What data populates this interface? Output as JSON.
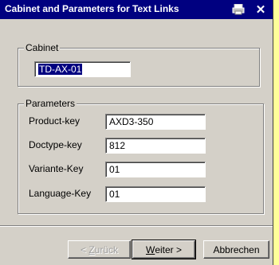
{
  "window": {
    "title": "Cabinet and Parameters for Text Links",
    "icons": [
      "printer-icon",
      "close-icon"
    ],
    "close_glyph": "✕"
  },
  "cabinet": {
    "group_label": "Cabinet",
    "value": "TD-AX-01"
  },
  "parameters": {
    "group_label": "Parameters",
    "fields": [
      {
        "label": "Product-key",
        "value": "AXD3-350"
      },
      {
        "label": "Doctype-key",
        "value": "812"
      },
      {
        "label": "Variante-Key",
        "value": "01"
      },
      {
        "label": "Language-Key",
        "value": "01"
      }
    ]
  },
  "buttons": {
    "back_prefix": "< ",
    "back_mnemonic": "Z",
    "back_rest": "urück",
    "next_mnemonic": "W",
    "next_rest": "eiter >",
    "cancel": "Abbrechen"
  },
  "colors": {
    "titlebar": "#000080",
    "dialog": "#d4d0c8",
    "background": "#ffff99"
  }
}
